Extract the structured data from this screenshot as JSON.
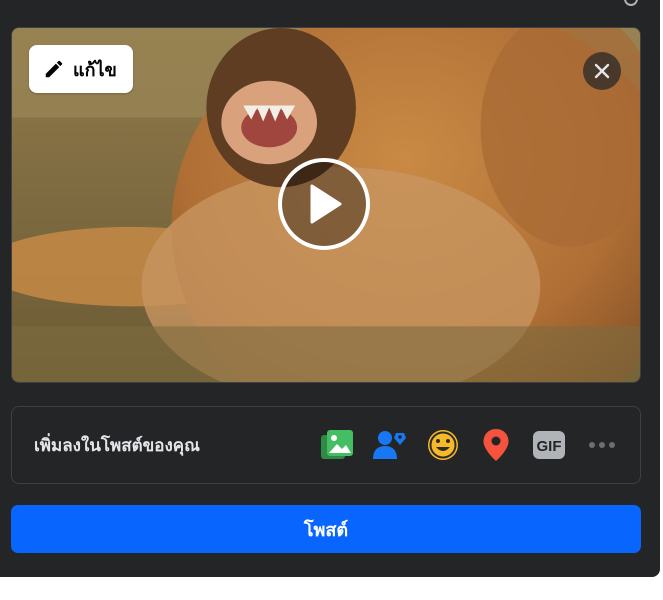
{
  "media": {
    "edit_label": "แก้ไข"
  },
  "add_to_post": {
    "label": "เพิ่มลงในโพสต์ของคุณ",
    "icons": [
      "photo-video-icon",
      "tag-people-icon",
      "feeling-icon",
      "check-in-icon",
      "gif-icon",
      "more-icon"
    ],
    "gif_text": "GIF"
  },
  "post_button": {
    "label": "โพสต์"
  },
  "colors": {
    "dialog_bg": "#242526",
    "primary": "#0866ff",
    "photo_green": "#45bd62",
    "tag_blue": "#1877f2",
    "feeling_yellow": "#f7b928",
    "checkin_red": "#f5533d",
    "gif_gray": "#b0b3b8"
  }
}
